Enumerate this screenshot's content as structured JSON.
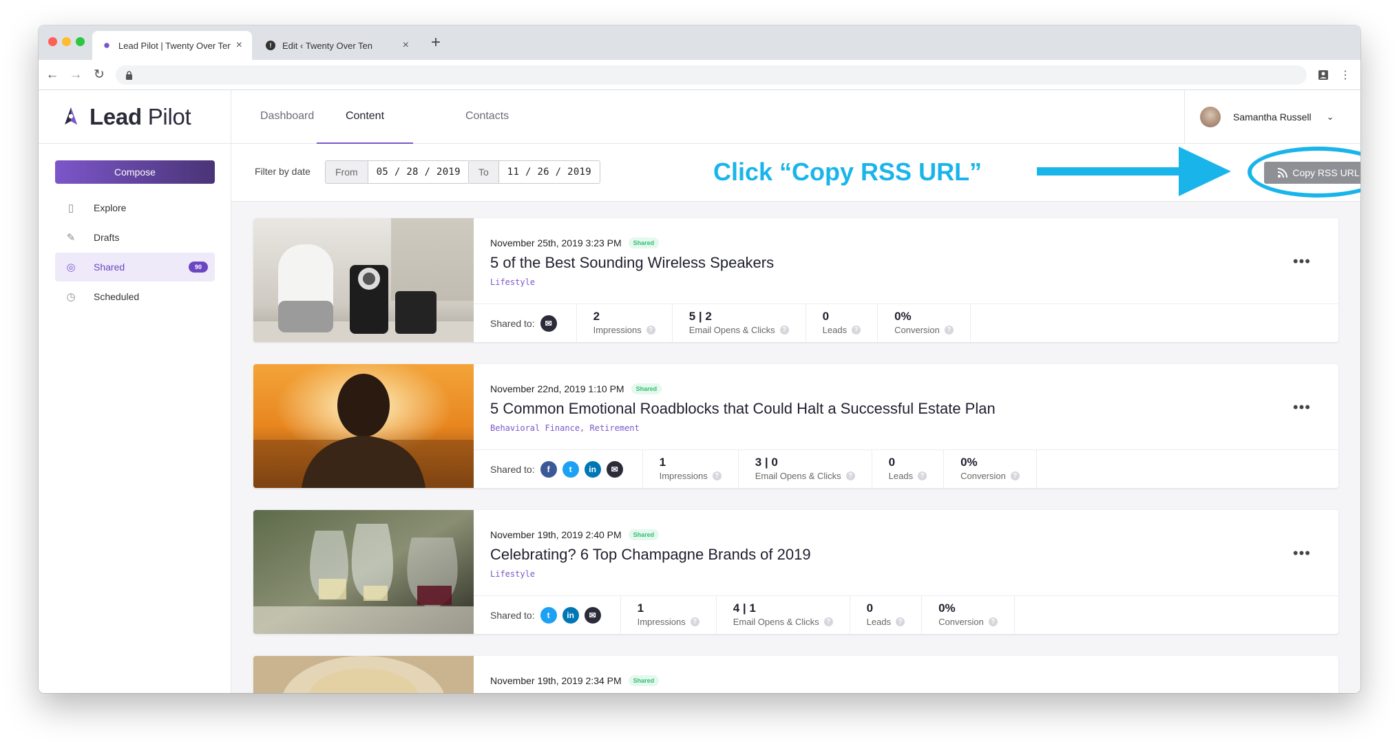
{
  "browser": {
    "tabs": [
      {
        "title": "Lead Pilot | Twenty Over Ten",
        "close": "×",
        "active": true
      },
      {
        "title": "Edit ‹ Twenty Over Ten",
        "close": "×",
        "active": false
      }
    ],
    "new_tab": "+"
  },
  "app": {
    "logo": {
      "bold": "Lead",
      "rest": " Pilot"
    },
    "compose_label": "Compose",
    "sidebar": [
      {
        "label": "Explore",
        "icon": "explore-icon"
      },
      {
        "label": "Drafts",
        "icon": "pencil-icon"
      },
      {
        "label": "Shared",
        "icon": "shared-icon",
        "badge": "90",
        "active": true
      },
      {
        "label": "Scheduled",
        "icon": "clock-icon"
      }
    ],
    "topnav": [
      "Dashboard",
      "Content",
      "Contacts"
    ],
    "active_topnav": "Content",
    "user": {
      "name": "Samantha Russell"
    }
  },
  "filter": {
    "label": "Filter by date",
    "from_label": "From",
    "from_date": "05 / 28 / 2019",
    "to_label": "To",
    "to_date": "11 / 26 / 2019",
    "rss_button": "Copy RSS URL"
  },
  "annotation": {
    "text": "Click “Copy RSS URL”",
    "color": "#19b5ea"
  },
  "posts": [
    {
      "date": "November 25th, 2019 3:23 PM",
      "status": "Shared",
      "title": "5 of the Best Sounding Wireless Speakers",
      "tags": "Lifestyle",
      "shared_label": "Shared to:",
      "channels": [
        "email"
      ],
      "stats": [
        {
          "value": "2",
          "label": "Impressions"
        },
        {
          "value": "5 | 2",
          "label": "Email Opens & Clicks"
        },
        {
          "value": "0",
          "label": "Leads"
        },
        {
          "value": "0%",
          "label": "Conversion"
        }
      ]
    },
    {
      "date": "November 22nd, 2019 1:10 PM",
      "status": "Shared",
      "title": "5 Common Emotional Roadblocks that Could Halt a Successful Estate Plan",
      "tags": "Behavioral Finance, Retirement",
      "shared_label": "Shared to:",
      "channels": [
        "facebook",
        "twitter",
        "linkedin",
        "email"
      ],
      "stats": [
        {
          "value": "1",
          "label": "Impressions"
        },
        {
          "value": "3 | 0",
          "label": "Email Opens & Clicks"
        },
        {
          "value": "0",
          "label": "Leads"
        },
        {
          "value": "0%",
          "label": "Conversion"
        }
      ]
    },
    {
      "date": "November 19th, 2019 2:40 PM",
      "status": "Shared",
      "title": "Celebrating? 6 Top Champagne Brands of 2019",
      "tags": "Lifestyle",
      "shared_label": "Shared to:",
      "channels": [
        "twitter",
        "linkedin",
        "email"
      ],
      "stats": [
        {
          "value": "1",
          "label": "Impressions"
        },
        {
          "value": "4 | 1",
          "label": "Email Opens & Clicks"
        },
        {
          "value": "0",
          "label": "Leads"
        },
        {
          "value": "0%",
          "label": "Conversion"
        }
      ]
    },
    {
      "date": "November 19th, 2019 2:34 PM",
      "status": "Shared",
      "title": "",
      "tags": "",
      "shared_label": "",
      "channels": [],
      "stats": []
    }
  ],
  "colors": {
    "accent": "#7c56c9",
    "annotation": "#19b5ea",
    "shared_green": "#2fbf71"
  }
}
